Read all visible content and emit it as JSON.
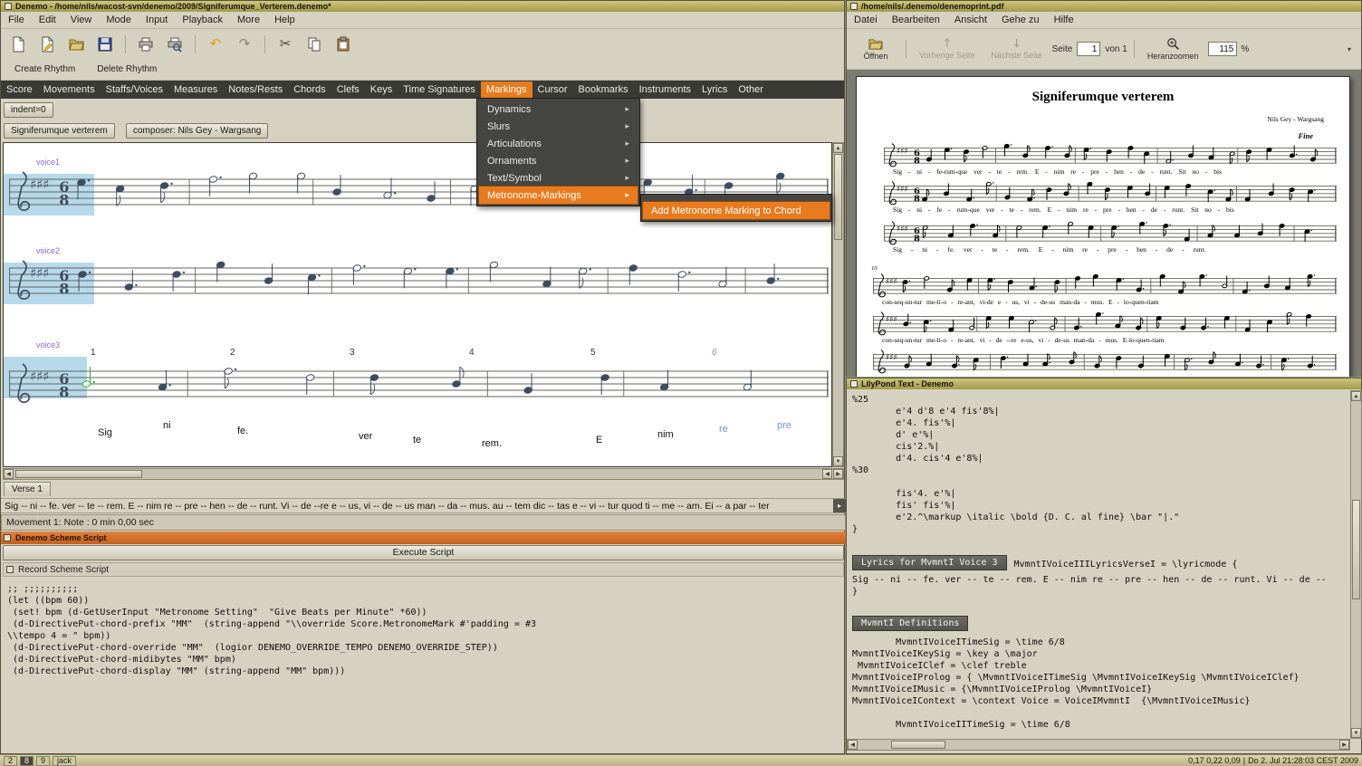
{
  "taskbar": {
    "items": [
      "2",
      "8",
      "9",
      "jack"
    ],
    "load": "0,17 0,22 0,09",
    "clock": "Do 2. Jul 21:28:03 CEST 2009"
  },
  "denemo": {
    "title": "Denemo  -  /home/nils/wacost-svn/denemo/2009/Signiferumque_Verterem.denemo*",
    "menubar": [
      "File",
      "Edit",
      "View",
      "Mode",
      "Input",
      "Playback",
      "More",
      "Help"
    ],
    "toolbar_icons": [
      "new-document",
      "new-from-template",
      "open-folder",
      "save",
      "print",
      "print-preview",
      "undo",
      "redo",
      "cut",
      "copy",
      "paste"
    ],
    "rhythm_buttons": [
      "Create Rhythm",
      "Delete Rhythm"
    ],
    "command_bar": [
      "Score",
      "Movements",
      "Staffs/Voices",
      "Measures",
      "Notes/Rests",
      "Chords",
      "Clefs",
      "Keys",
      "Time Signatures",
      "Markings",
      "Cursor",
      "Bookmarks",
      "Instruments",
      "Lyrics",
      "Other"
    ],
    "indent_button": "indent=0",
    "title_button": "Signiferumque verterem",
    "composer_button": "composer: Nils Gey - Wargsang",
    "voice_labels": [
      "voice1",
      "voice2",
      "voice3"
    ],
    "time_signature": {
      "upper": "6",
      "lower": "8"
    },
    "measure_numbers": [
      "1",
      "2",
      "3",
      "4",
      "5",
      "6"
    ],
    "score_lyrics": [
      "Sig",
      "ni",
      "fe.",
      "ver",
      "te",
      "rem.",
      "E",
      "nim",
      "re",
      "pre"
    ],
    "markings_menu": {
      "items": [
        "Dynamics",
        "Slurs",
        "Articulations",
        "Ornaments",
        "Text/Symbol",
        "Metronome-Markings"
      ],
      "submenu_item": "Add Metronome Marking to Chord"
    },
    "verse_tab": "Verse 1",
    "verse_line": "Sig -- ni -- fe. ver -- te -- rem. E -- nim re -- pre -- hen -- de -- runt. Vi -- de --re e -- us, vi -- de -- us man -- da -- mus.  au -- tem dic -- tas e -- vi -- tur quod ti -- me -- am. Ei -- a par -- ter",
    "status": "Movement 1: Note : 0 min 0,00 sec",
    "scheme": {
      "panel_title": "Denemo Scheme Script",
      "execute_button": "Execute Script",
      "record_title": "Record Scheme Script",
      "script": [
        ";; ;;;;;;;;;;",
        "(let ((bpm 60))",
        " (set! bpm (d-GetUserInput \"Metronome Setting\"  \"Give Beats per Minute\" *60))",
        " (d-DirectivePut-chord-prefix \"MM\"  (string-append \"\\\\override Score.MetronomeMark #'padding = #3",
        "\\\\tempo 4 = \" bpm))",
        " (d-DirectivePut-chord-override \"MM\"  (logior DENEMO_OVERRIDE_TEMPO DENEMO_OVERRIDE_STEP))",
        " (d-DirectivePut-chord-midibytes \"MM\" bpm)",
        " (d-DirectivePut-chord-display \"MM\" (string-append \"MM\" bpm)))"
      ]
    }
  },
  "pdf": {
    "title": "/home/nils/.denemo/denemoprint.pdf",
    "menubar": [
      "Datei",
      "Bearbeiten",
      "Ansicht",
      "Gehe zu",
      "Hilfe"
    ],
    "toolbar": {
      "open": "Öffnen",
      "prev": "Vorherige Seite",
      "next": "Nächste Seite",
      "page_label": "Seite",
      "page_value": "1",
      "page_total": "von 1",
      "zoom_label": "Heranzoomen",
      "zoom_value": "115",
      "percent": "%"
    },
    "page": {
      "title": "Signiferumque verterem",
      "composer": "Nils Gey - Wargsang",
      "fine": "Fine",
      "measure_number": "10",
      "time_signature": {
        "upper": "6",
        "lower": "8"
      },
      "lyrics": [
        "Sig - ni - fe-rum-que ver - te - rem.  E - nim  re - pre - hen - de - runt.  Sit  no - bis",
        "Sig - ni - fe - rum-que ver - te - rem.  E - nim  re - pre - hen - de - runt.  Sit  no - bis",
        "Sig - ni - fe.   ver - te - rem.   E - nim  re - pre - hen - de - runt.",
        "con-seq-un-tur me-li-o - re-ant,  vi-de e - us,  vi - de-us man-da -  mus.  E - lo-quen-tiam",
        "con-seq-un-tur me-li-o - re-ant, vi - de --re e-us, vi  -  de-us man-da -  mus.  E-lo-quen-tiam"
      ]
    }
  },
  "lilypond": {
    "title": "LilyPond Text - Denemo",
    "code_top": [
      "%25",
      "        e'4 d'8 e'4 fis'8%|",
      "        e'4. fis'%|",
      "        d' e'%|",
      "        cis'2.%|",
      "        d'4. cis'4 e'8%|",
      "%30",
      "",
      "        fis'4. e'%|",
      "        fis' fis'%|",
      "        e'2.^\\markup \\italic \\bold {D. C. al fine} \\bar \"|.\"",
      "}"
    ],
    "lyrics_button": "Lyrics for MvmntI Voice 3",
    "lyrics_header": "MvmntIVoiceIIILyricsVerseI = \\lyricmode {",
    "lyrics_block": [
      "Sig -- ni -- fe. ver -- te -- rem. E -- nim re -- pre -- hen -- de -- runt. Vi -- de --",
      "}"
    ],
    "definitions_button": "MvmntI Definitions",
    "definitions": [
      "        MvmntIVoiceITimeSig = \\time 6/8",
      "MvmntIVoiceIKeySig = \\key a \\major",
      " MvmntIVoiceIClef = \\clef treble",
      "MvmntIVoiceIProlog = { \\MvmntIVoiceITimeSig \\MvmntIVoiceIKeySig \\MvmntIVoiceIClef}",
      "MvmntIVoiceIMusic = {\\MvmntIVoiceIProlog \\MvmntIVoiceI}",
      "MvmntIVoiceIContext = \\context Voice = VoiceIMvmntI  {\\MvmntIVoiceIMusic}",
      "",
      "        MvmntIVoiceIITimeSig = \\time 6/8"
    ]
  }
}
